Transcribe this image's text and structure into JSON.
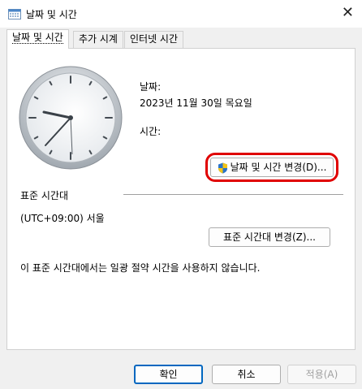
{
  "window": {
    "title": "날짜 및 시간",
    "close_glyph": "✕"
  },
  "tabs": [
    {
      "label": "날짜 및 시간",
      "active": true
    },
    {
      "label": "추가 시계",
      "active": false
    },
    {
      "label": "인터넷 시간",
      "active": false
    }
  ],
  "date_section": {
    "date_label": "날짜:",
    "date_value": "2023년 11월 30일 목요일",
    "time_label": "시간:"
  },
  "change_datetime_button": "날짜 및 시간 변경(D)...",
  "timezone": {
    "heading": "표준 시간대",
    "value": "(UTC+09:00) 서울",
    "change_button": "표준 시간대 변경(Z)..."
  },
  "dst_note": "이 표준 시간대에서는 일광 절약 시간을 사용하지 않습니다.",
  "footer": {
    "ok": "확인",
    "cancel": "취소",
    "apply": "적용(A)"
  },
  "colors": {
    "highlight": "#e00000",
    "accent": "#0067c0"
  }
}
